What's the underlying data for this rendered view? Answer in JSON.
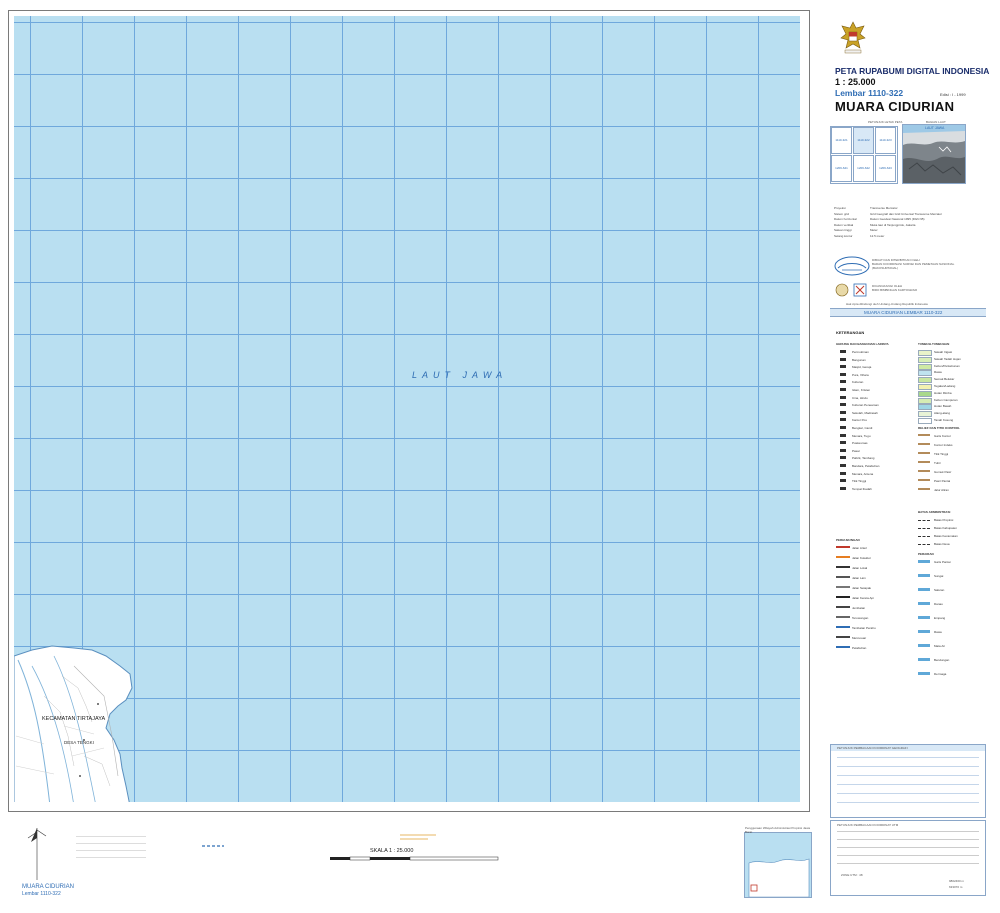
{
  "map": {
    "sea_label": "LAUT JAWA",
    "district_label": "KECAMATAN TIRTAJAYA",
    "village_label": "DESA TENGKI"
  },
  "sidebar": {
    "series_title": "PETA RUPABUMI DIGITAL INDONESIA",
    "scale": "1 : 25.000",
    "sheet_label": "Lembar 1110-322",
    "edition": "Edisi : I - 1999",
    "sheet_name": "MUARA CIDURIAN",
    "index_heading_left": "PETUNJUK LETAK PETA",
    "index_heading_right": "BAGIAN LAUT",
    "index_sea": "LAUT JAWA",
    "index_cells": [
      "1110-321",
      "1110-322",
      "1110-323",
      "1209-641",
      "1209-642",
      "1209-643"
    ],
    "info_labels": [
      "Proyeksi",
      "Sistem grid",
      "Datum horizontal",
      "Datum vertikal",
      "Satuan tinggi",
      "Selang kontur"
    ],
    "info_values": [
      "Transverse Mercator",
      "Grid Geografi dan Grid Universal Transverse Mercator",
      "Datum Geodesi Nasional 1995 (DGN 95)",
      "Muka laut di Tanjungpriok, Jakarta",
      "Meter",
      "12.5 meter"
    ],
    "publisher_1": "DIBUAT DAN DITERBITKAN OLEH",
    "publisher_1b": "BADAN KOORDINASI SURVEI DAN PEMETAAN NASIONAL",
    "publisher_1c": "(BAKOSURTANAL)",
    "publisher_2": "DICANGKANGI OLEH",
    "publisher_2b": "BIRO BIMBINGAN KARTOGRAFI",
    "copyright": "Hak cipta dilindungi oleh Undang-Undang Republik Indonesia",
    "footer_band": "MUARA CIDURIAN LEMBAR 1110-322"
  },
  "legend": {
    "title": "KETERANGAN",
    "col1_heading": "GEDUNG DAN BANGUNAN LAINNYA",
    "col2_heading": "TUMBUH-TUMBUHAN",
    "col1_items": [
      "Permukiman",
      "Bangunan",
      "Masjid, Gereja",
      "Pura, Vihara",
      "Kuburan",
      "Islam, Kristen",
      "Cina, Hindu",
      "Kuburan Peneaman",
      "Sekolah, Madrasah",
      "Kantor Pos",
      "Bengkel, Candi",
      "Menara, Tugu",
      "Puskesmas",
      "Pasar",
      "Pabrik, Tambang",
      "Bandara, Pelabuhan",
      "Menara, Antena",
      "Titik Tinggi",
      "Tempat Ibadah"
    ],
    "col2_items": [
      "Sawah Irigasi",
      "Sawah Tadah Hujan",
      "Kebun/Perkebunan",
      "Rawa",
      "Semak Belukar",
      "Tegalan/Ladang",
      "Hutan Rimba",
      "Kebun Campuran",
      "Hutan Basah",
      "Alang-alang",
      "Tanah Kosong"
    ],
    "col2b_heading": "RELIEF DAN TITIK KONTROL",
    "col2b_items": [
      "Garis Kontur",
      "Kontur Indeks",
      "Titik Tinggi",
      "Tubir",
      "Gumuk Pasir",
      "Pasir Pantai",
      "Jalur Aliran"
    ],
    "col2c_heading": "BATAS ADMINISTRASI",
    "col2c_items": [
      "Batas Propinsi",
      "Batas Kabupaten",
      "Batas Kecamatan",
      "Batas Desa"
    ],
    "col1b_heading": "PERHUBUNGAN",
    "col1b_items": [
      "Jalan Arteri",
      "Jalan Kolektor",
      "Jalan Lokal",
      "Jalan Lain",
      "Jalan Setapak",
      "Jalan Kereta Api",
      "Jembatan",
      "Terowongan",
      "Tambatan Perahu",
      "Mercusuar",
      "Pelabuhan"
    ],
    "col2d_heading": "PERAIRAN",
    "col2d_items": [
      "Garis Pantai",
      "Sungai",
      "Saluran",
      "Danau",
      "Empang",
      "Rawa",
      "Mata Air",
      "Bendungan",
      "Dermaga"
    ]
  },
  "bottom": {
    "sheet_name": "MUARA CIDURIAN",
    "sheet_number": "Lembar 1110-322",
    "scale_label": "SKALA 1 : 25.000",
    "box_note": "Penggunaan Wilayah Administrasi Propinsi Jawa Barat",
    "grid_heading": "PETUNJUK PEMBACAAN KOORDINAT GEOGRAFI",
    "grid_heading_2": "PETUNJUK PEMBACAAN KOORDINAT UTM",
    "utm_1": "9802460 m",
    "utm_2": "633070 m",
    "utm_zone": "ZONE UTM : 48"
  },
  "colors": {
    "sea": "#b9dff1",
    "grid": "#6fa8dc",
    "land": "#ffffff",
    "title_blue": "#2f6db4"
  }
}
